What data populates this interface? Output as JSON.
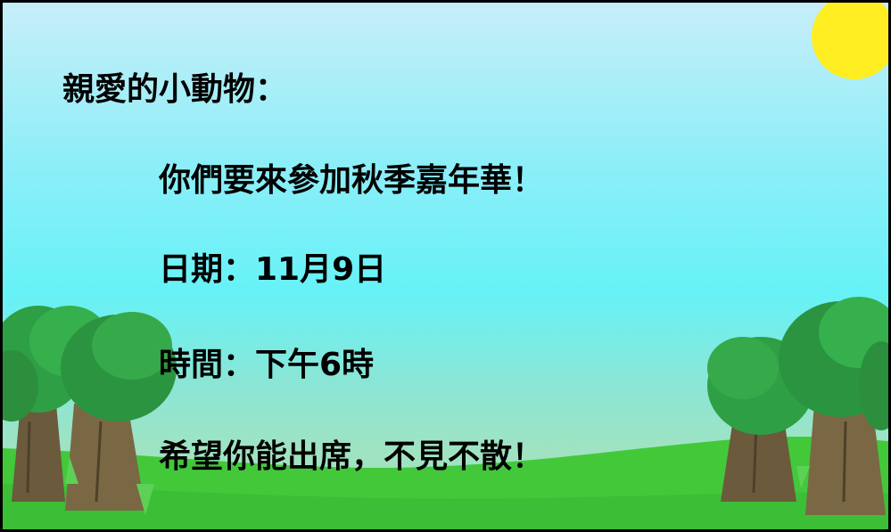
{
  "invitation": {
    "greeting": "親愛的小動物：",
    "invite": "你們要來參加秋季嘉年華！",
    "date": "日期：11月9日",
    "time": "時間：下午6時",
    "closing": "希望你能出席，不見不散！"
  },
  "colors": {
    "sky_top": "#c7eef9",
    "sky_mid": "#66f2f7",
    "grass": "#43c83a",
    "sun": "#ffee22",
    "tree_foliage": "#2e9f45",
    "tree_trunk": "#6b5a3c"
  }
}
